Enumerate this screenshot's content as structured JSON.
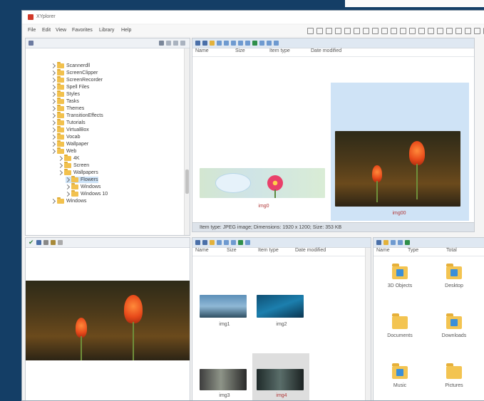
{
  "window": {
    "title": "XYplorer"
  },
  "menu": [
    "File",
    "Edit",
    "View",
    "Favorites",
    "Library",
    "Help"
  ],
  "tree": {
    "items": [
      {
        "label": "Scannerdll",
        "indent": 1,
        "selected": false
      },
      {
        "label": "ScreenClipper",
        "indent": 1,
        "selected": false
      },
      {
        "label": "ScreenRecorder",
        "indent": 1,
        "selected": false
      },
      {
        "label": "Spell Files",
        "indent": 1,
        "selected": false
      },
      {
        "label": "Styles",
        "indent": 1,
        "selected": false
      },
      {
        "label": "Tasks",
        "indent": 1,
        "selected": false
      },
      {
        "label": "Themes",
        "indent": 1,
        "selected": false
      },
      {
        "label": "TransitionEffects",
        "indent": 1,
        "selected": false
      },
      {
        "label": "Tutorials",
        "indent": 1,
        "selected": false
      },
      {
        "label": "VirtualBox",
        "indent": 1,
        "selected": false
      },
      {
        "label": "Vocab",
        "indent": 1,
        "selected": false
      },
      {
        "label": "Wallpaper",
        "indent": 1,
        "selected": false
      },
      {
        "label": "Web",
        "indent": 1,
        "selected": false
      },
      {
        "label": "4K",
        "indent": 2,
        "selected": false
      },
      {
        "label": "Screen",
        "indent": 2,
        "selected": false
      },
      {
        "label": "Wallpapers",
        "indent": 2,
        "selected": false
      },
      {
        "label": "Flowers",
        "indent": 3,
        "selected": true
      },
      {
        "label": "Windows",
        "indent": 3,
        "selected": false
      },
      {
        "label": "Windows 10",
        "indent": 3,
        "selected": false
      },
      {
        "label": "Windows",
        "indent": 1,
        "selected": false
      }
    ]
  },
  "file_pane_top": {
    "columns": [
      "Name",
      "Size",
      "Item type",
      "Date modified"
    ],
    "thumbs": [
      {
        "caption": "img0"
      },
      {
        "caption": "img00"
      }
    ]
  },
  "status": {
    "text": "Item type: JPEG image; Dimensions: 1920 x 1200; Size: 353 KB"
  },
  "file_pane_bottom": {
    "columns": [
      "Name",
      "Size",
      "Item type",
      "Date modified"
    ],
    "thumbs": [
      {
        "caption": "img1"
      },
      {
        "caption": "img2"
      },
      {
        "caption": "img3"
      },
      {
        "caption": "img4"
      }
    ]
  },
  "right_pane": {
    "columns": [
      "Name",
      "Type",
      "Total"
    ],
    "tiles": [
      {
        "caption": "3D Objects",
        "icon": "folder-3d-icon"
      },
      {
        "caption": "Desktop",
        "icon": "folder-desktop-icon"
      },
      {
        "caption": "Documents",
        "icon": "folder-documents-icon"
      },
      {
        "caption": "Downloads",
        "icon": "folder-downloads-icon"
      },
      {
        "caption": "Music",
        "icon": "folder-music-icon"
      },
      {
        "caption": "Pictures",
        "icon": "folder-pictures-icon"
      }
    ]
  },
  "colors": {
    "background": "#143e66",
    "selection": "#cfe3f6",
    "folder": "#f2c14e",
    "caption": "#b23a3a"
  }
}
